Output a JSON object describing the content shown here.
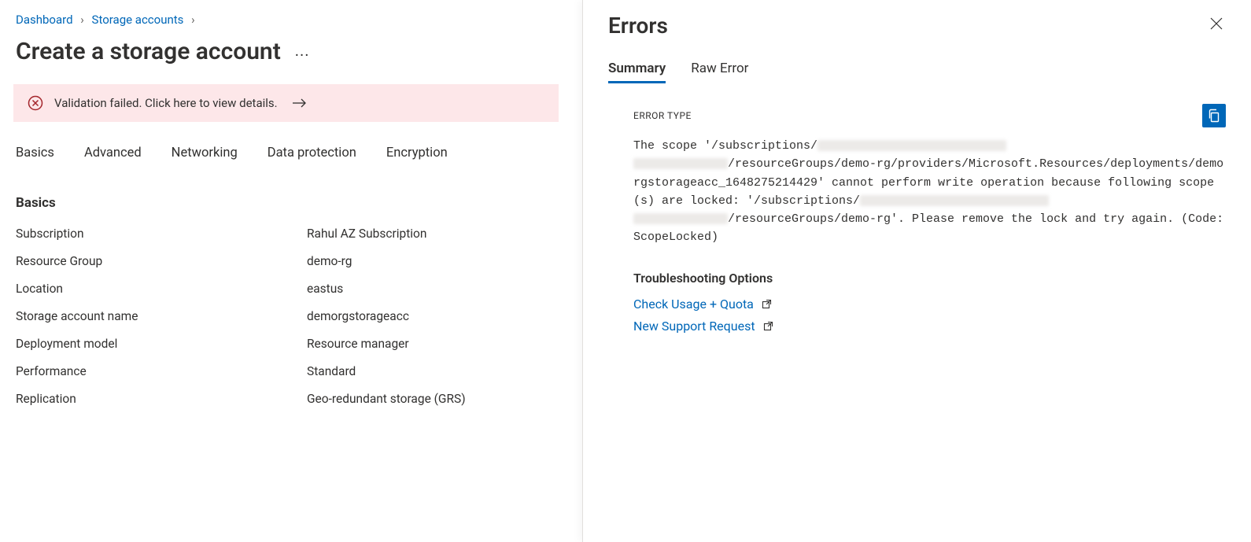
{
  "breadcrumb": {
    "dashboard": "Dashboard",
    "storage_accounts": "Storage accounts"
  },
  "page_title": "Create a storage account",
  "validation_msg": "Validation failed. Click here to view details.",
  "tabs": {
    "basics": "Basics",
    "advanced": "Advanced",
    "networking": "Networking",
    "data_protection": "Data protection",
    "encryption": "Encryption"
  },
  "section_heading": "Basics",
  "kv": {
    "subscription_k": "Subscription",
    "subscription_v": "Rahul AZ Subscription",
    "rg_k": "Resource Group",
    "rg_v": "demo-rg",
    "location_k": "Location",
    "location_v": "eastus",
    "name_k": "Storage account name",
    "name_v": "demorgstorageacc",
    "deploy_k": "Deployment model",
    "deploy_v": "Resource manager",
    "perf_k": "Performance",
    "perf_v": "Standard",
    "repl_k": "Replication",
    "repl_v": "Geo-redundant storage (GRS)"
  },
  "panel": {
    "title": "Errors",
    "tab_summary": "Summary",
    "tab_raw": "Raw Error",
    "error_type_label": "ERROR TYPE",
    "error_parts": {
      "p1": "The scope '/subscriptions/",
      "p2": "/resourceGroups/demo-rg/providers/Microsoft.Resources/deployments/demorgstorageacc_1648275214429' cannot perform write operation because following scope(s) are locked: '/subscriptions/",
      "p3": "/resourceGroups/demo-rg'. Please remove the lock and try again. (Code: ScopeLocked)"
    },
    "troubleshoot_heading": "Troubleshooting Options",
    "link_quota": "Check Usage + Quota",
    "link_support": "New Support Request"
  }
}
